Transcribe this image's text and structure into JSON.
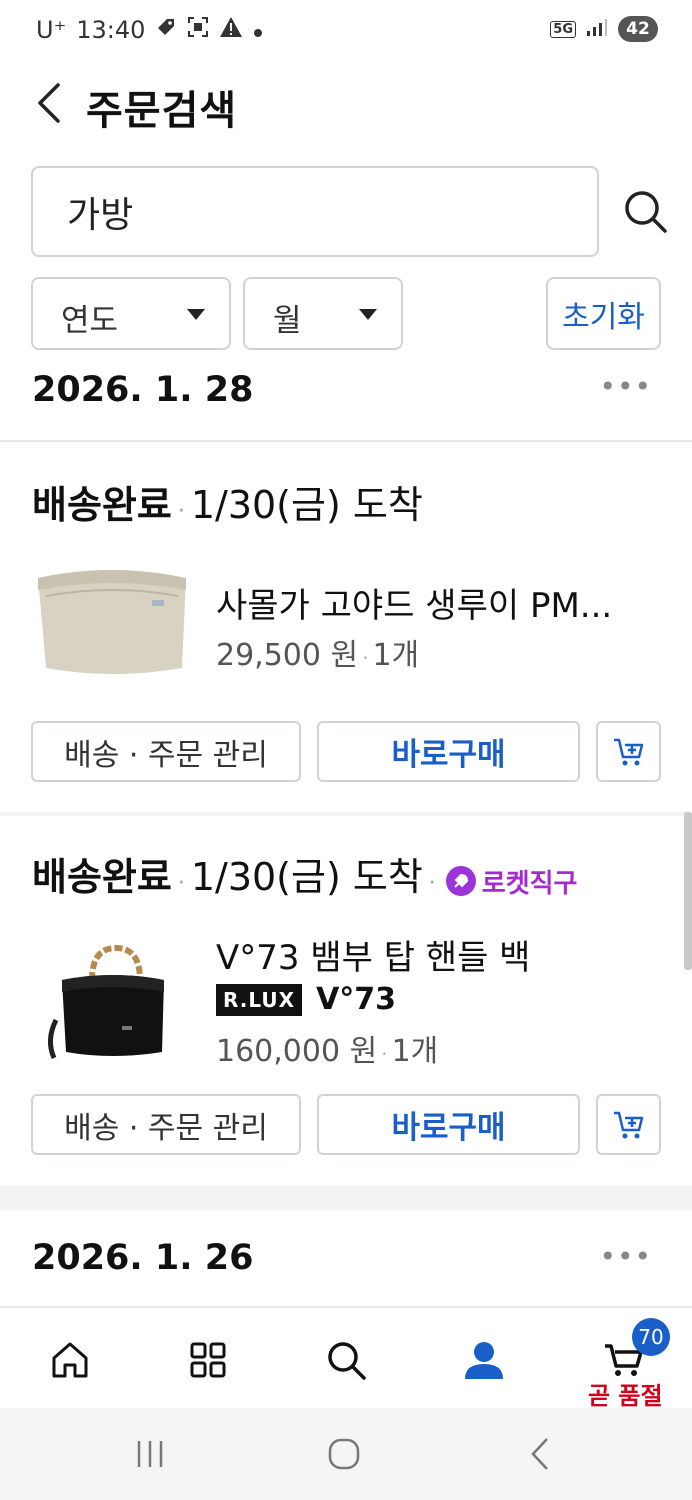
{
  "status_bar": {
    "carrier": "U⁺",
    "time": "13:40",
    "battery": "42",
    "network": "5G"
  },
  "header": {
    "title": "주문검색"
  },
  "search": {
    "value": "가방"
  },
  "filters": {
    "year_label": "연도",
    "month_label": "월",
    "reset_label": "초기화"
  },
  "date_groups": [
    {
      "date": "2026. 1. 28"
    },
    {
      "date": "2026. 1. 26"
    }
  ],
  "orders": [
    {
      "status": "배송완료",
      "arrival": "1/30(금) 도착",
      "product_name": "사몰가 고야드 생루이 PM...",
      "price": "29,500 원",
      "quantity": "1개",
      "manage_label": "배송 · 주문 관리",
      "buy_label": "바로구매"
    },
    {
      "status": "배송완료",
      "arrival": "1/30(금) 도착",
      "badge": "로켓직구",
      "product_name": "V°73 뱀부 탑 핸들 백",
      "brand_badge": "R.LUX",
      "brand_name": "V°73",
      "price": "160,000 원",
      "quantity": "1개",
      "manage_label": "배송 · 주문 관리",
      "buy_label": "바로구매"
    }
  ],
  "bottom_nav": {
    "cart_count": "70",
    "cart_notice": "곧 품절"
  },
  "colors": {
    "accent": "#1a5fc9",
    "rocket": "#a42bd1",
    "soldout": "#d0021b"
  }
}
